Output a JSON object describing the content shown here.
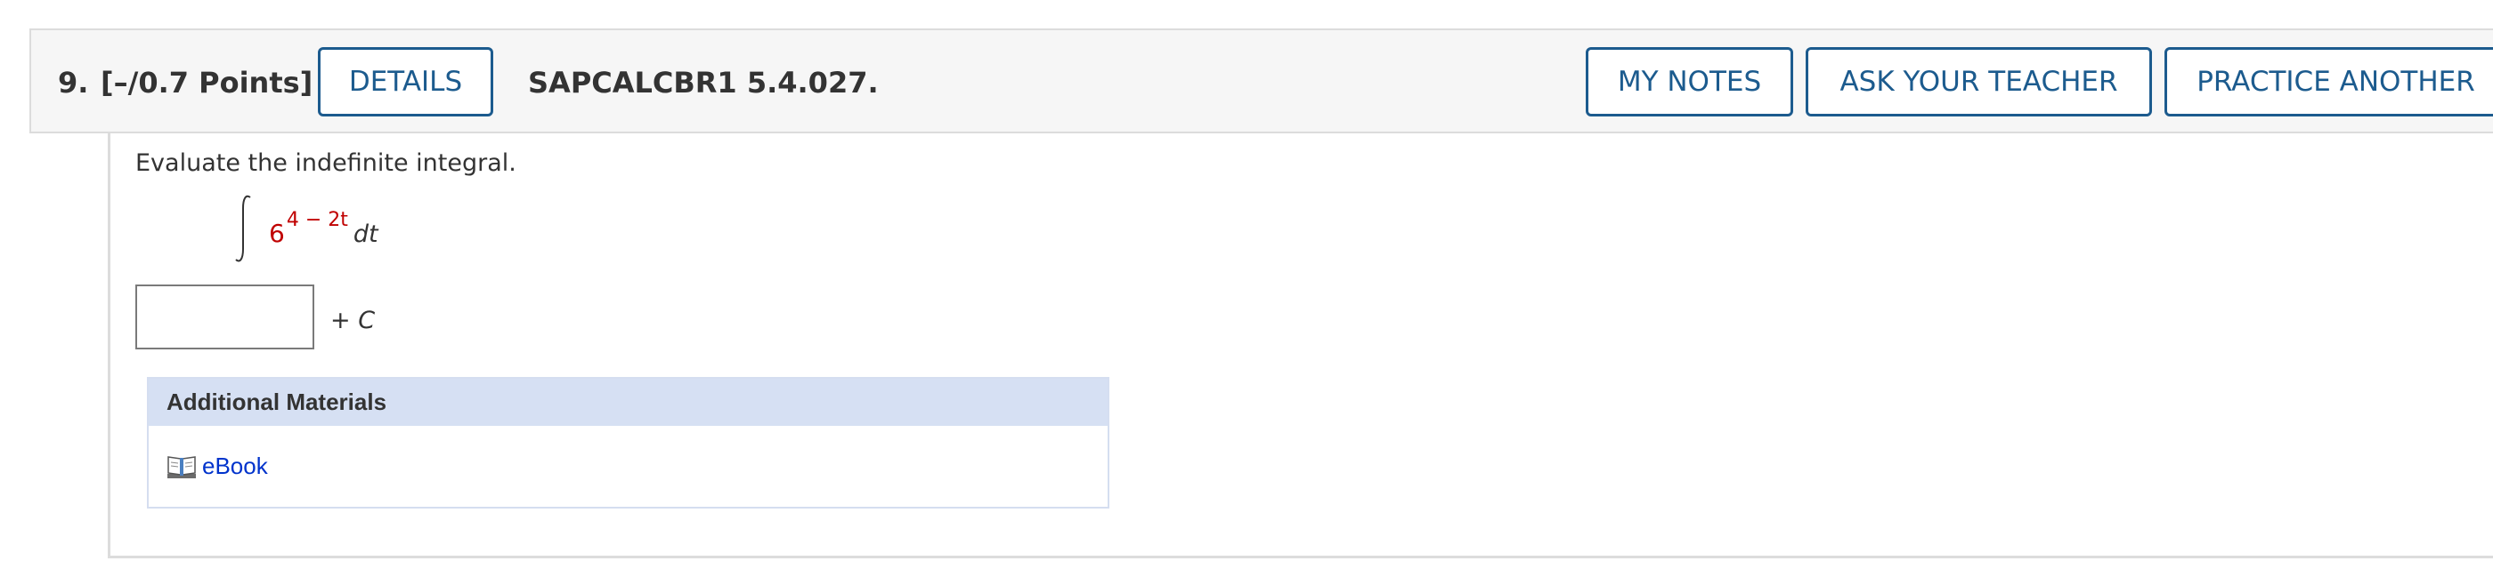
{
  "question": {
    "number": "9.",
    "points": "[–/0.7 Points]",
    "problem_id": "SAPCALCBR1 5.4.027."
  },
  "header_buttons": {
    "details": "DETAILS",
    "my_notes": "MY NOTES",
    "ask_teacher": "ASK YOUR TEACHER",
    "practice_another": "PRACTICE ANOTHER"
  },
  "problem": {
    "instruction": "Evaluate the indefinite integral.",
    "integrand_base": "6",
    "integrand_exponent": "4 − 2t",
    "differential": "dt",
    "answer_value": "",
    "constant_prefix": "+ ",
    "constant": "C"
  },
  "additional_materials": {
    "title": "Additional Materials",
    "links": [
      {
        "label": "eBook",
        "icon": "book-icon"
      }
    ]
  },
  "colors": {
    "button_accent": "#1c5b8e",
    "math_highlight": "#c00000",
    "link": "#0033cc",
    "materials_header": "#d6e0f3"
  }
}
